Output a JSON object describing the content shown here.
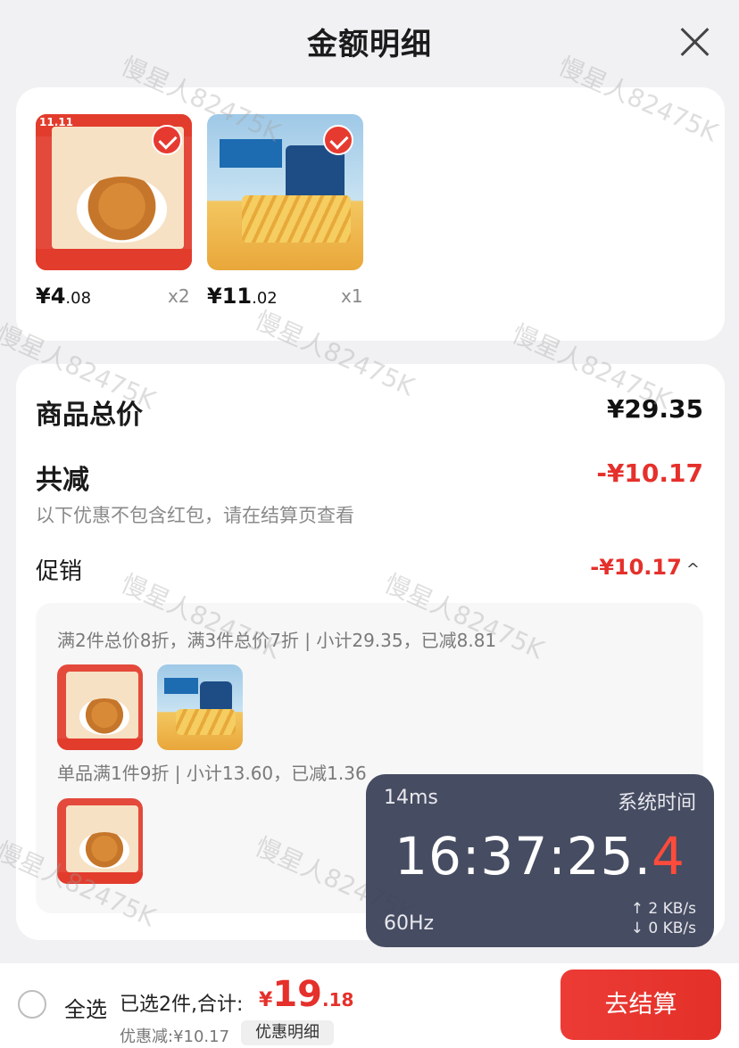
{
  "header": {
    "title": "金额明细"
  },
  "products": [
    {
      "name_badge": "11.11",
      "price_int": "¥4",
      "price_dec": ".08",
      "qty": "x2"
    },
    {
      "price_int": "¥11",
      "price_dec": ".02",
      "qty": "x1"
    }
  ],
  "summary": {
    "total_label": "商品总价",
    "total_value": "¥29.35",
    "reduce_label": "共减",
    "reduce_value": "-¥10.17",
    "reduce_note": "以下优惠不包含红包，请在结算页查看",
    "promo_label": "促销",
    "promo_value": "-¥10.17",
    "promo_toggle": "^",
    "promo_line_1": "满2件总价8折，满3件总价7折 | 小计29.35，已减8.81",
    "promo_line_2": "单品满1件9折 | 小计13.60，已减1.36"
  },
  "overlay": {
    "latency": "14ms",
    "sys_label": "系统时间",
    "clock_main": "16:37:25.",
    "clock_last": "4",
    "refresh": "60Hz",
    "up": "↑ 2 KB/s",
    "down": "↓ 0 KB/s"
  },
  "bottom": {
    "select_all": "全选",
    "selected_text": "已选2件,合计:",
    "total_symbol": "¥",
    "total_int": "19",
    "total_dec": ".18",
    "discount_text": "优惠减:¥10.17",
    "discount_detail": "优惠明细",
    "checkout": "去结算"
  },
  "watermark": "慢星人82475K",
  "colors": {
    "accent": "#e5302b",
    "overlay_bg": "#3c4258"
  }
}
